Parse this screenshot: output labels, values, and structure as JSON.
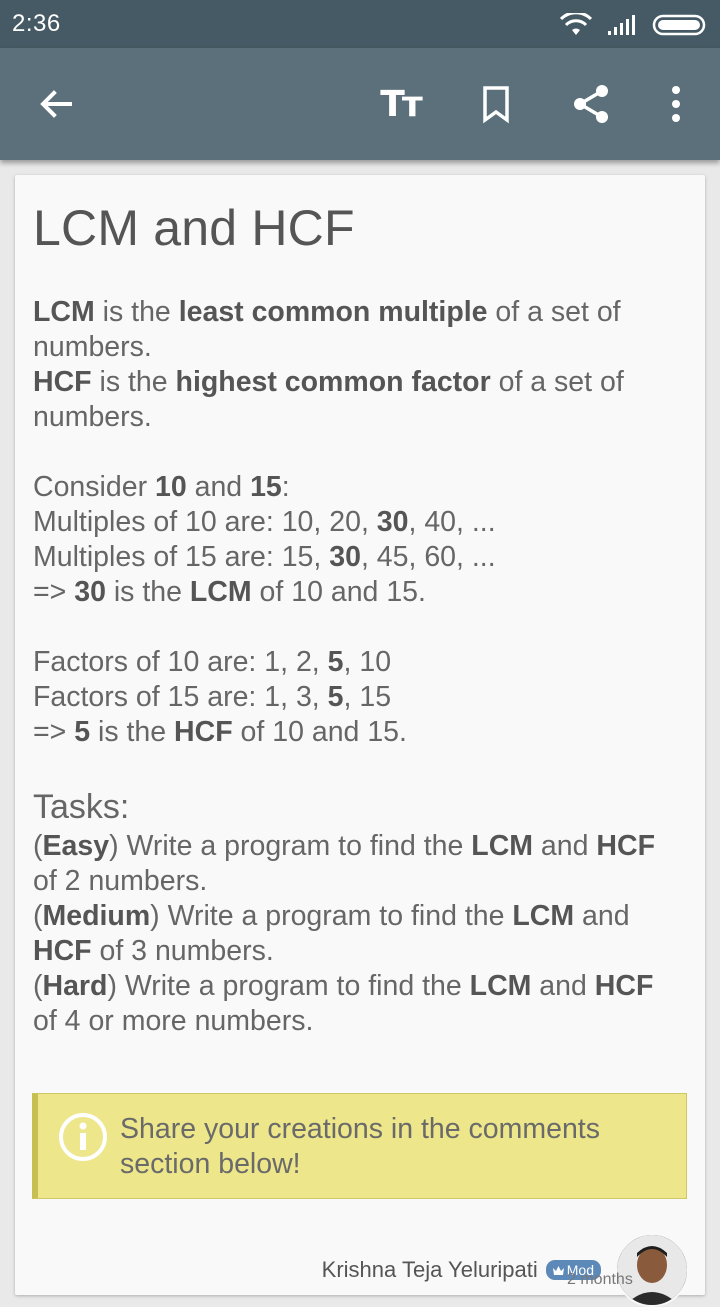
{
  "status_bar": {
    "time": "2:36"
  },
  "app_bar": {
    "icons": [
      "back-arrow-icon",
      "text-size-icon",
      "bookmark-icon",
      "share-icon",
      "more-vert-icon"
    ],
    "text_size_glyph": "Tт"
  },
  "article": {
    "title": "LCM and HCF",
    "intro": [
      {
        "parts": [
          {
            "b": "LCM"
          },
          {
            "t": " is the "
          },
          {
            "b": "least common multiple"
          },
          {
            "t": " of a set of"
          }
        ]
      },
      {
        "parts": [
          {
            "t": "numbers."
          }
        ]
      },
      {
        "parts": [
          {
            "b": "HCF"
          },
          {
            "t": " is the "
          },
          {
            "b": "highest common factor"
          },
          {
            "t": " of a set of"
          }
        ]
      },
      {
        "parts": [
          {
            "t": "numbers."
          }
        ]
      }
    ],
    "lcm_example": [
      {
        "parts": [
          {
            "t": "Consider "
          },
          {
            "b": "10"
          },
          {
            "t": " and "
          },
          {
            "b": "15"
          },
          {
            "t": ":"
          }
        ]
      },
      {
        "parts": [
          {
            "t": "Multiples of 10 are: 10, 20, "
          },
          {
            "b": "30"
          },
          {
            "t": ", 40, ..."
          }
        ]
      },
      {
        "parts": [
          {
            "t": "Multiples of 15 are: 15, "
          },
          {
            "b": "30"
          },
          {
            "t": ", 45, 60, ..."
          }
        ]
      },
      {
        "parts": [
          {
            "t": "=> "
          },
          {
            "b": "30"
          },
          {
            "t": " is the "
          },
          {
            "b": "LCM"
          },
          {
            "t": " of 10 and 15."
          }
        ]
      }
    ],
    "hcf_example": [
      {
        "parts": [
          {
            "t": "Factors of 10 are: 1, 2, "
          },
          {
            "b": "5"
          },
          {
            "t": ", 10"
          }
        ]
      },
      {
        "parts": [
          {
            "t": "Factors of 15 are: 1, 3, "
          },
          {
            "b": "5"
          },
          {
            "t": ", 15"
          }
        ]
      },
      {
        "parts": [
          {
            "t": "=> "
          },
          {
            "b": "5"
          },
          {
            "t": " is the "
          },
          {
            "b": "HCF"
          },
          {
            "t": " of 10 and 15."
          }
        ]
      }
    ],
    "tasks_heading": "Tasks:",
    "tasks": [
      {
        "parts": [
          {
            "t": "("
          },
          {
            "b": "Easy"
          },
          {
            "t": ") Write a program to find the "
          },
          {
            "b": "LCM"
          },
          {
            "t": " and "
          },
          {
            "b": "HCF"
          }
        ]
      },
      {
        "parts": [
          {
            "t": "of 2 numbers."
          }
        ]
      },
      {
        "parts": [
          {
            "t": "("
          },
          {
            "b": "Medium"
          },
          {
            "t": ") Write a program to find the "
          },
          {
            "b": "LCM"
          },
          {
            "t": " and"
          }
        ]
      },
      {
        "parts": [
          {
            "b": "HCF"
          },
          {
            "t": " of 3 numbers."
          }
        ]
      },
      {
        "parts": [
          {
            "t": "("
          },
          {
            "b": "Hard"
          },
          {
            "t": ") Write a program to find the "
          },
          {
            "b": "LCM"
          },
          {
            "t": " and "
          },
          {
            "b": "HCF"
          }
        ]
      },
      {
        "parts": [
          {
            "t": "of 4 or more numbers."
          }
        ]
      }
    ],
    "info_box": {
      "icon": "info-icon",
      "line1": "Share your creations in the comments",
      "line2": "section below!"
    },
    "author": {
      "name": "Krishna Teja Yeluripati",
      "badge": "Mod",
      "badge_icon": "crown-icon",
      "sub": "2 months"
    }
  }
}
